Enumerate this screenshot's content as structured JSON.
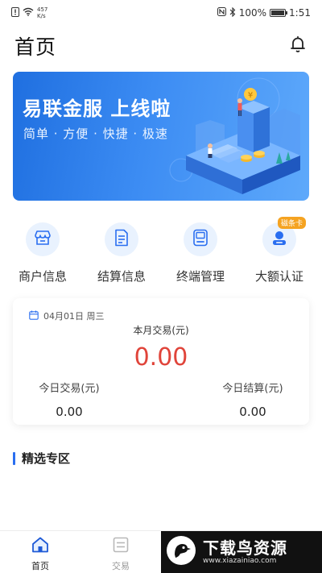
{
  "status_bar": {
    "speed_value": "457",
    "speed_unit": "K/s",
    "battery": "100%",
    "time": "1:51",
    "battery_level": 100
  },
  "header": {
    "title": "首页",
    "bell_icon": "bell-icon"
  },
  "banner": {
    "title": "易联金服  上线啦",
    "subtitle": "简单 · 方便 · 快捷 · 极速"
  },
  "quick_actions": [
    {
      "label": "商户信息",
      "icon": "store-icon"
    },
    {
      "label": "结算信息",
      "icon": "document-icon"
    },
    {
      "label": "终端管理",
      "icon": "pos-terminal-icon"
    },
    {
      "label": "大额认证",
      "icon": "user-verify-icon",
      "badge": "磁条卡"
    }
  ],
  "stats": {
    "date": "04月01日 周三",
    "month_label": "本月交易(元)",
    "month_value": "0.00",
    "today_trade_label": "今日交易(元)",
    "today_trade_value": "0.00",
    "today_settle_label": "今日结算(元)",
    "today_settle_value": "0.00"
  },
  "section": {
    "title": "精选专区"
  },
  "bottom_nav": [
    {
      "label": "首页",
      "icon": "home-icon",
      "active": true
    },
    {
      "label": "交易",
      "icon": "transaction-icon",
      "active": false
    }
  ],
  "watermark": {
    "text": "下载鸟资源",
    "url": "www.xiazainiao.com"
  },
  "colors": {
    "accent": "#2a6ef0",
    "amount_red": "#e0443a",
    "banner_blue": "#3c8cf3",
    "badge_orange": "#f5a321"
  }
}
